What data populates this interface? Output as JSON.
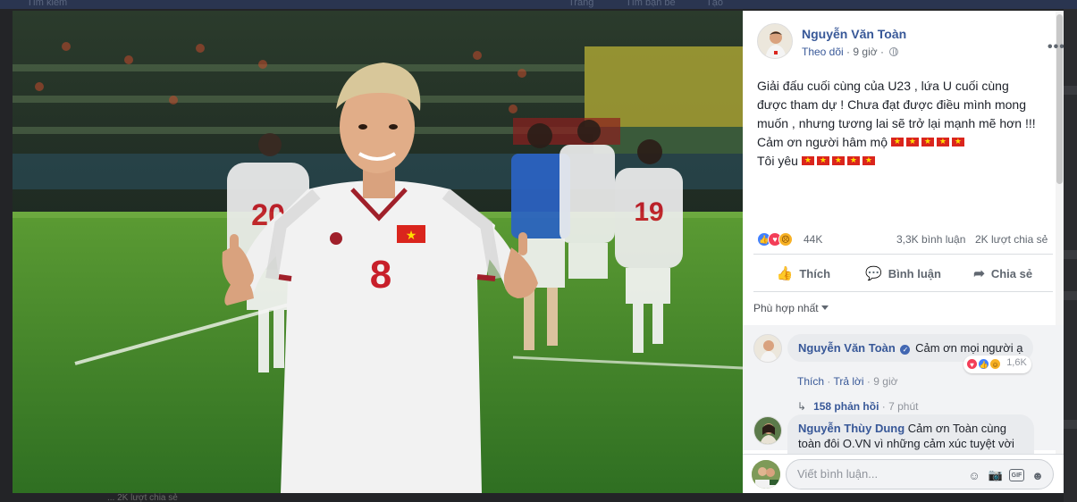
{
  "background": {
    "search_placeholder": "Tìm kiếm",
    "nav_items": [
      "Trang",
      "Tìm bạn bè",
      "Tạo"
    ],
    "bottom_text": "... 2K lượt chia sẻ"
  },
  "photo": {
    "player_number": "8",
    "left_player_number": "20",
    "right_player_number": "19"
  },
  "post": {
    "author": "Nguyễn Văn Toàn",
    "follow_label": "Theo dõi",
    "separator": "·",
    "time": "9 giờ",
    "more_label": "•••",
    "text_lines": [
      "Giải đấu cuối cùng của U23 , lứa U cuối cùng",
      "được tham dự ! Chưa đạt được điều mình mong",
      "muốn , nhưng tương lai sẽ trở lại mạnh mẽ hơn !!!",
      "Cảm ơn người hâm mộ",
      "Tôi yêu"
    ],
    "flags_line4": 5,
    "flags_line5": 5,
    "reaction_count": "44K",
    "comment_count": "3,3K bình luận",
    "share_count": "2K lượt chia sẻ",
    "actions": {
      "like": "Thích",
      "comment": "Bình luận",
      "share": "Chia sẻ"
    },
    "sort_label": "Phù hợp nhất"
  },
  "comments": [
    {
      "name": "Nguyễn Văn Toàn",
      "verified": true,
      "text": "Cảm ơn mọi người ạ",
      "like_label": "Thích",
      "reply_label": "Trả lời",
      "time": "9 giờ",
      "reaction_count": "1,6K",
      "replies_label": "158 phản hồi",
      "replies_time": "7 phút"
    },
    {
      "name": "Nguyễn Thùy Dung",
      "text_line1": "Cảm ơn Toàn cùng",
      "text_line2": "toàn đôi O.VN vì những cảm xúc tuyệt vời"
    }
  ],
  "composer": {
    "placeholder": "Viết bình luận..."
  },
  "colors": {
    "link": "#385898",
    "pitch": "#3f8a2c",
    "jersey": "#f2f2f2",
    "flag_red": "#da251d",
    "flag_star": "#ffde00"
  }
}
